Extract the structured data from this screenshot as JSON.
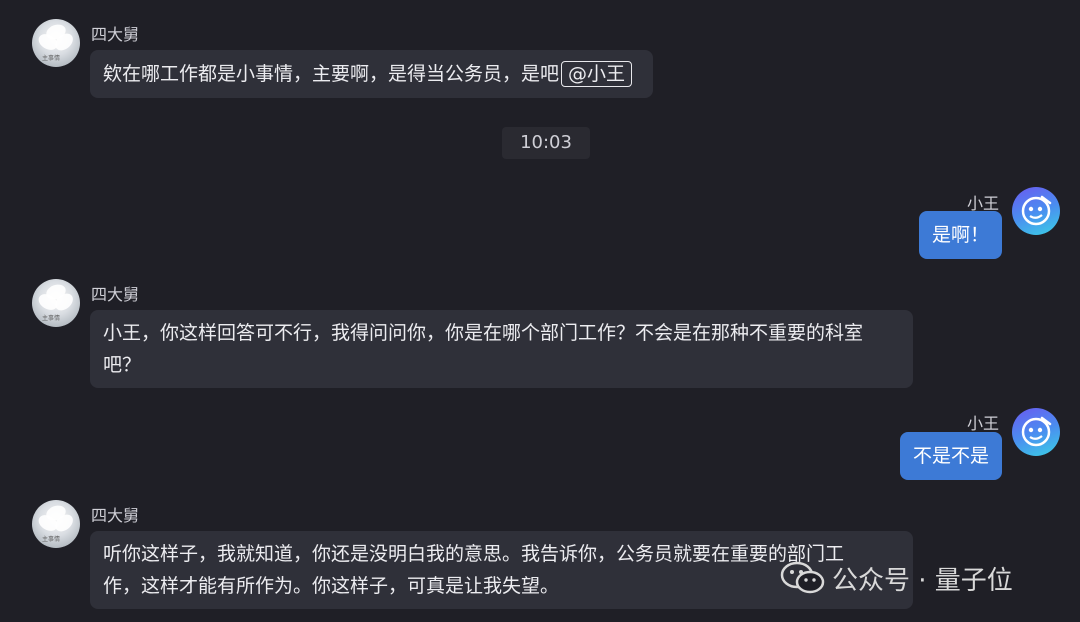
{
  "messages": [
    {
      "sender": "四大舅",
      "side": "left",
      "text": "欸在哪工作都是小事情，主要啊，是得当公务员，是吧",
      "mention": "@小王"
    },
    {
      "sender": "小王",
      "side": "right",
      "text": "是啊！"
    },
    {
      "sender": "四大舅",
      "side": "left",
      "lines": [
        "小王，你这样回答可不行，我得问问你，你是在哪个部门工作？不会是在那种不重要的科室",
        "吧？"
      ]
    },
    {
      "sender": "小王",
      "side": "right",
      "text": "不是不是"
    },
    {
      "sender": "四大舅",
      "side": "left",
      "lines": [
        "听你这样子，我就知道，你还是没明白我的意思。我告诉你，公务员就要在重要的部门工",
        "作，这样才能有所作为。你这样子，可真是让我失望。"
      ]
    }
  ],
  "timestamp": "10:03",
  "watermark": {
    "text": "公众号 · 量子位",
    "icon": "wechat-icon"
  },
  "avatar_other_text": "主事情"
}
